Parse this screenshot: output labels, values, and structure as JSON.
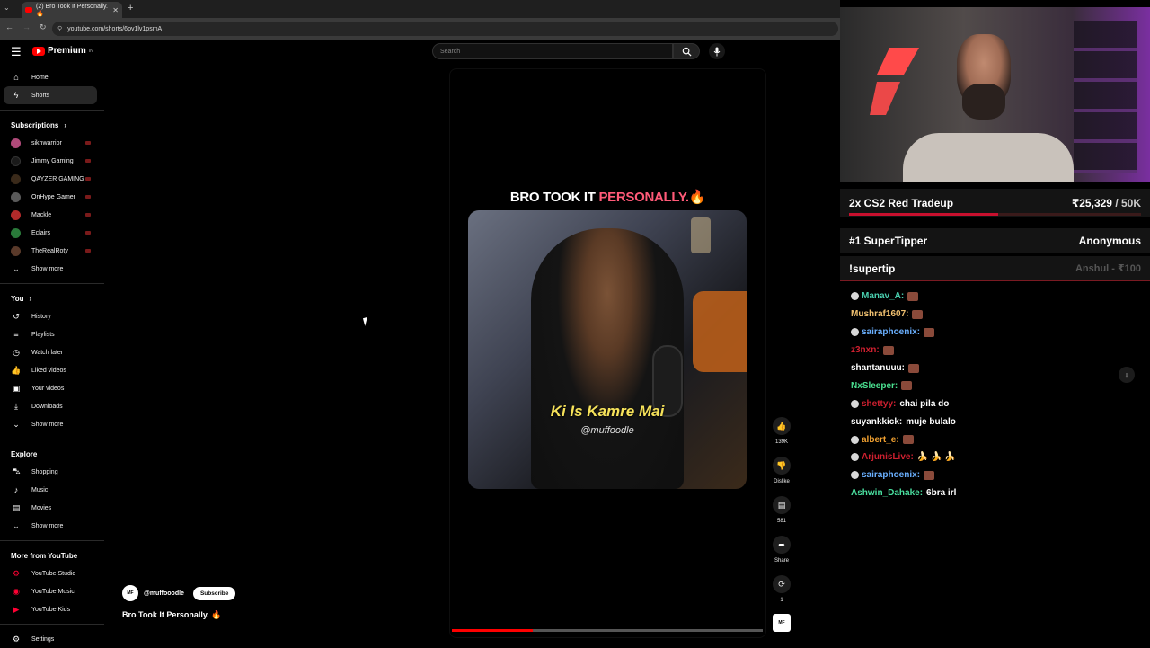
{
  "browser": {
    "tab_title": "(2) Bro Took It Personally. 🔥",
    "url": "youtube.com/shorts/6pv1lv1psmA"
  },
  "header": {
    "logo_text": "Premium",
    "logo_tm": "IN",
    "search_placeholder": "Search"
  },
  "sidebar": {
    "primary": [
      {
        "label": "Home",
        "icon": "home-icon"
      },
      {
        "label": "Shorts",
        "icon": "shorts-icon",
        "active": true
      }
    ],
    "subscriptions_title": "Subscriptions",
    "subscriptions": [
      {
        "label": "sikhwarrior",
        "color": "#b04a7a"
      },
      {
        "label": "Jimmy Gaming",
        "color": "#1a1a1a"
      },
      {
        "label": "QAYZER GAMING",
        "color": "#3a2a1a"
      },
      {
        "label": "OnHype Gamer",
        "color": "#5a5a5a"
      },
      {
        "label": "Mackle",
        "color": "#b02a2a"
      },
      {
        "label": "Eclairs",
        "color": "#2a7a3a"
      },
      {
        "label": "TheRealRoty",
        "color": "#5a3a2a"
      }
    ],
    "show_more_1": "Show more",
    "you_title": "You",
    "you_items": [
      {
        "label": "History",
        "icon": "history-icon"
      },
      {
        "label": "Playlists",
        "icon": "playlists-icon"
      },
      {
        "label": "Watch later",
        "icon": "watch-later-icon"
      },
      {
        "label": "Liked videos",
        "icon": "liked-videos-icon"
      },
      {
        "label": "Your videos",
        "icon": "your-videos-icon"
      },
      {
        "label": "Downloads",
        "icon": "downloads-icon"
      }
    ],
    "show_more_2": "Show more",
    "explore_title": "Explore",
    "explore_items": [
      {
        "label": "Shopping",
        "icon": "shopping-icon"
      },
      {
        "label": "Music",
        "icon": "music-icon"
      },
      {
        "label": "Movies",
        "icon": "movies-icon"
      }
    ],
    "show_more_3": "Show more",
    "more_title": "More from YouTube",
    "more_items": [
      {
        "label": "YouTube Studio",
        "icon": "youtube-studio-icon"
      },
      {
        "label": "YouTube Music",
        "icon": "youtube-music-icon"
      },
      {
        "label": "YouTube Kids",
        "icon": "youtube-kids-icon"
      }
    ],
    "settings": "Settings"
  },
  "short": {
    "title_part1": "BRO TOOK IT ",
    "title_part2": "PERSONALLY.🔥",
    "caption": "Ki Is Kamre Mai",
    "watermark": "@muffoodle",
    "progress": 0.26,
    "channel_avatar": "MF",
    "channel": "@muffooodle",
    "subscribe": "Subscribe",
    "name": "Bro Took It Personally. 🔥"
  },
  "actions": {
    "likes": "139K",
    "dislike": "Dislike",
    "comments": "581",
    "share": "Share",
    "remix": "1",
    "rail_avatar": "MF"
  },
  "overlay": {
    "goal_title": "2x CS2 Red Tradeup",
    "goal_amount": "₹25,329",
    "goal_max": "/ 50K",
    "goal_progress": 0.51,
    "tipper_title": "#1 SuperTipper",
    "tipper_name": "Anonymous",
    "supertip_cmd": "!supertip",
    "supertip_who": "Anshul - ₹100",
    "chat": [
      {
        "user": "Manav_A:",
        "color": "#4ad0b0",
        "mod": true,
        "text": "",
        "emote": true
      },
      {
        "user": "Mushraf1607:",
        "color": "#f0c070",
        "mod": false,
        "text": "",
        "emote": true
      },
      {
        "user": "sairaphoenix:",
        "color": "#6ab0ff",
        "mod": true,
        "text": "",
        "emote": true
      },
      {
        "user": "z3nxn:",
        "color": "#d02030",
        "mod": false,
        "text": "",
        "emote": true
      },
      {
        "user": "shantanuuu:",
        "color": "#ffffff",
        "mod": false,
        "text": "",
        "emote": true
      },
      {
        "user": "NxSleeper:",
        "color": "#4ae090",
        "mod": false,
        "text": "",
        "emote": true
      },
      {
        "user": "shettyy:",
        "color": "#d02030",
        "mod": true,
        "text": "chai pila do",
        "emote": false
      },
      {
        "user": "suyankkick:",
        "color": "#ffffff",
        "mod": false,
        "text": "muje bulalo",
        "emote": false
      },
      {
        "user": "albert_e:",
        "color": "#f0a030",
        "mod": true,
        "text": "",
        "emote": true
      },
      {
        "user": "ArjunisLive:",
        "color": "#d02030",
        "mod": true,
        "text": "🍌 🍌 🍌",
        "emote": false
      },
      {
        "user": "sairaphoenix:",
        "color": "#6ab0ff",
        "mod": true,
        "text": "",
        "emote": true
      },
      {
        "user": "Ashwin_Dahake:",
        "color": "#4ae0a0",
        "mod": false,
        "text": "6bra irl",
        "emote": false
      }
    ]
  }
}
